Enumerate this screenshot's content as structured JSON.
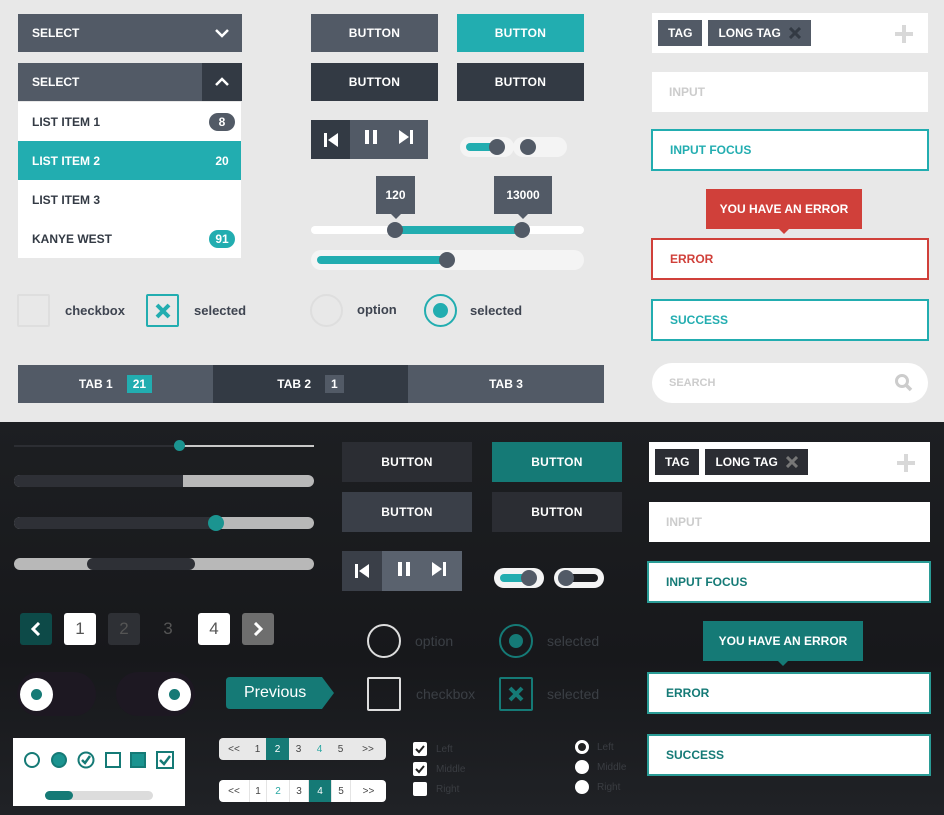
{
  "colors": {
    "teal": "#22adb0",
    "dark_teal": "#157a76",
    "slate": "#525a66",
    "charcoal": "#333a44",
    "error_red": "#d0403a"
  },
  "light": {
    "select_closed": {
      "label": "SELECT",
      "icon": "chevron-down-icon"
    },
    "select_open": {
      "label": "SELECT",
      "icon": "chevron-up-icon",
      "items": [
        {
          "label": "LIST ITEM 1",
          "badge": "8"
        },
        {
          "label": "LIST ITEM 2",
          "badge": "20",
          "selected": true
        },
        {
          "label": "LIST ITEM 3",
          "badge": ""
        },
        {
          "label": "KANYE WEST",
          "badge": "91"
        }
      ]
    },
    "buttons": [
      "BUTTON",
      "BUTTON",
      "BUTTON",
      "BUTTON"
    ],
    "media": {
      "prev": "skip-back-icon",
      "pause": "pause-icon",
      "next": "skip-forward-icon"
    },
    "toggles": [
      {
        "on": true
      },
      {
        "on": false
      }
    ],
    "range_slider": {
      "min_label": "120",
      "max_label": "13000",
      "low_fraction": 0.31,
      "high_fraction": 0.77
    },
    "slider": {
      "value_fraction": 0.5
    },
    "checkbox": {
      "label": "checkbox",
      "checked": false
    },
    "checkbox_selected": {
      "label": "selected",
      "checked": true
    },
    "radio": {
      "label": "option",
      "checked": false
    },
    "radio_selected": {
      "label": "selected",
      "checked": true
    },
    "tabs": [
      {
        "label": "TAB 1",
        "badge": "21"
      },
      {
        "label": "TAB 2",
        "badge": "1",
        "active": true
      },
      {
        "label": "TAB 3",
        "badge": ""
      }
    ],
    "tags": [
      "TAG",
      "LONG TAG"
    ],
    "input": {
      "placeholder": "INPUT"
    },
    "input_focus": {
      "value": "INPUT FOCUS"
    },
    "error_tooltip": "YOU HAVE AN ERROR",
    "error_input": {
      "value": "ERROR"
    },
    "success_input": {
      "value": "SUCCESS"
    },
    "search": {
      "placeholder": "SEARCH"
    }
  },
  "dark": {
    "sliders": [
      {
        "value_fraction": 0.55
      },
      {
        "value_fraction": 0.57
      },
      {
        "value_fraction": 0.68
      },
      {
        "range": [
          0.25,
          0.6
        ]
      }
    ],
    "buttons": [
      "BUTTON",
      "BUTTON",
      "BUTTON",
      "BUTTON"
    ],
    "toggles": [
      {
        "on": true
      },
      {
        "on": false
      }
    ],
    "pagination": {
      "prev": "chevron-left-icon",
      "pages": [
        "1",
        "2",
        "3",
        "4"
      ],
      "next": "chevron-right-icon"
    },
    "radio": {
      "label": "option"
    },
    "radio_selected": {
      "label": "selected"
    },
    "checkbox": {
      "label": "checkbox"
    },
    "checkbox_selected": {
      "label": "selected"
    },
    "previous_button": "Previous",
    "progress": {
      "value_fraction": 0.18
    },
    "pager1": {
      "items": [
        "<<",
        "1",
        "2",
        "3",
        "4",
        "5",
        ">>"
      ],
      "active": "2"
    },
    "pager2": {
      "items": [
        "<<",
        "1",
        "2",
        "3",
        "4",
        "5",
        ">>"
      ],
      "active": "4"
    },
    "check_list": [
      {
        "label": "Left",
        "checked": true
      },
      {
        "label": "Middle",
        "checked": true
      },
      {
        "label": "Right",
        "checked": false
      }
    ],
    "radio_list": [
      {
        "label": "Left",
        "checked": true
      },
      {
        "label": "Middle",
        "checked": false
      },
      {
        "label": "Right",
        "checked": false
      }
    ],
    "tags": [
      "TAG",
      "LONG TAG"
    ],
    "input": {
      "placeholder": "INPUT"
    },
    "input_focus": {
      "value": "INPUT FOCUS"
    },
    "error_tooltip": "YOU HAVE AN ERROR",
    "error_input": {
      "value": "ERROR"
    },
    "success_input": {
      "value": "SUCCESS"
    }
  }
}
